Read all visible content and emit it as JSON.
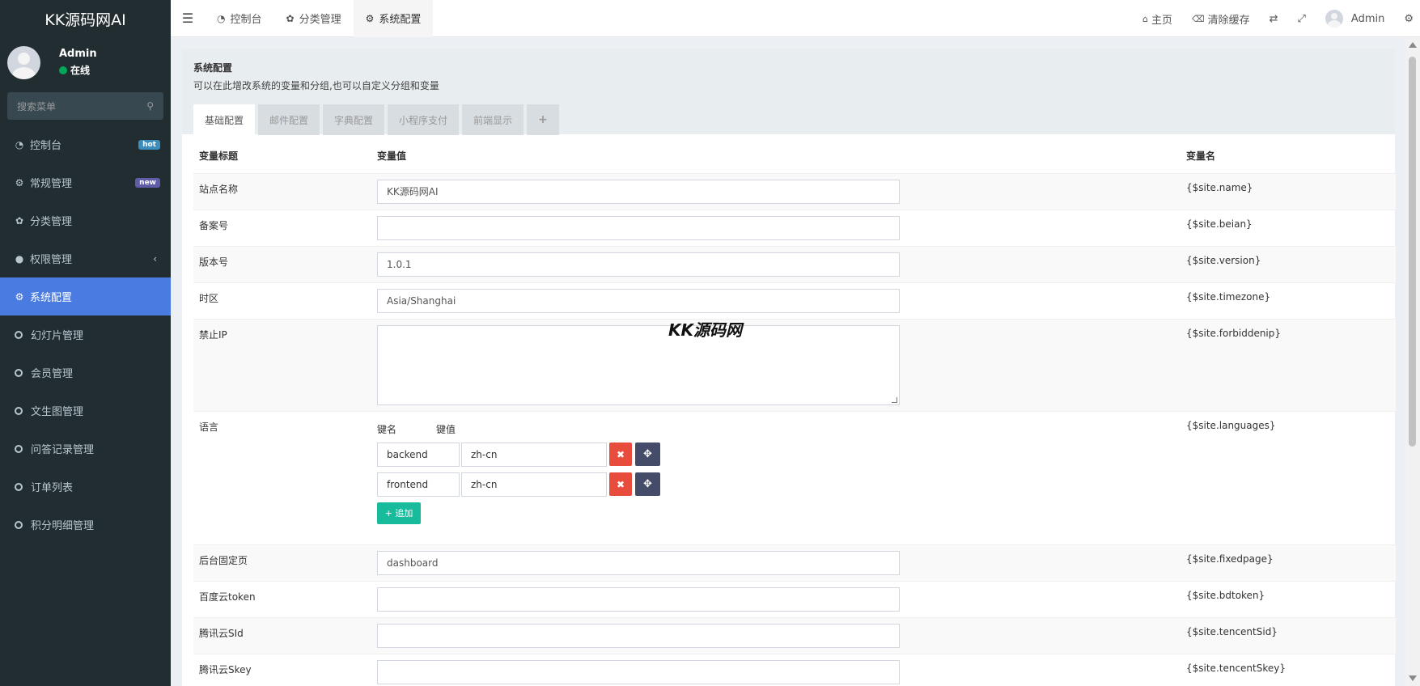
{
  "app": {
    "logo": "KK源码网AI"
  },
  "user": {
    "name": "Admin",
    "status": "在线"
  },
  "search": {
    "placeholder": "搜索菜单"
  },
  "sidebar": {
    "items": [
      {
        "label": "控制台",
        "icon": "dashboard-icon",
        "badge": "hot"
      },
      {
        "label": "常规管理",
        "icon": "cogs-icon",
        "badge": "new"
      },
      {
        "label": "分类管理",
        "icon": "leaf-icon"
      },
      {
        "label": "权限管理",
        "icon": "group-icon"
      },
      {
        "label": "系统配置",
        "icon": "gear-icon"
      },
      {
        "label": "幻灯片管理",
        "icon": "circle-icon"
      },
      {
        "label": "会员管理",
        "icon": "circle-icon"
      },
      {
        "label": "文生图管理",
        "icon": "circle-icon"
      },
      {
        "label": "问答记录管理",
        "icon": "circle-icon"
      },
      {
        "label": "订单列表",
        "icon": "circle-icon"
      },
      {
        "label": "积分明细管理",
        "icon": "circle-icon"
      }
    ]
  },
  "header": {
    "tabs": [
      {
        "label": "控制台",
        "icon": "dashboard-icon"
      },
      {
        "label": "分类管理",
        "icon": "leaf-icon"
      },
      {
        "label": "系统配置",
        "icon": "gear-icon"
      }
    ],
    "right": {
      "home": "主页",
      "clear_cache": "清除缓存",
      "user": "Admin"
    }
  },
  "panel": {
    "title": "系统配置",
    "description": "可以在此增改系统的变量和分组,也可以自定义分组和变量",
    "tabs": [
      "基础配置",
      "邮件配置",
      "字典配置",
      "小程序支付",
      "前端显示"
    ],
    "add_tab": "+"
  },
  "table": {
    "headers": {
      "title": "变量标题",
      "value": "变量值",
      "name": "变量名"
    },
    "rows": [
      {
        "title": "站点名称",
        "value": "KK源码网AI",
        "name": "{$site.name}"
      },
      {
        "title": "备案号",
        "value": "",
        "name": "{$site.beian}"
      },
      {
        "title": "版本号",
        "value": "1.0.1",
        "name": "{$site.version}"
      },
      {
        "title": "时区",
        "value": "Asia/Shanghai",
        "name": "{$site.timezone}"
      },
      {
        "title": "禁止IP",
        "value": "",
        "name": "{$site.forbiddenip}"
      },
      {
        "title": "语言",
        "name": "{$site.languages}"
      },
      {
        "title": "后台固定页",
        "value": "dashboard",
        "name": "{$site.fixedpage}"
      },
      {
        "title": "百度云token",
        "value": "",
        "name": "{$site.bdtoken}"
      },
      {
        "title": "腾讯云SId",
        "value": "",
        "name": "{$site.tencentSid}"
      },
      {
        "title": "腾讯云Skey",
        "value": "",
        "name": "{$site.tencentSkey}"
      }
    ],
    "languages": {
      "key_header": "键名",
      "value_header": "键值",
      "entries": [
        {
          "key": "backend",
          "value": "zh-cn"
        },
        {
          "key": "frontend",
          "value": "zh-cn"
        }
      ],
      "add_label": "+ 追加"
    }
  },
  "watermark": "KK源码网"
}
